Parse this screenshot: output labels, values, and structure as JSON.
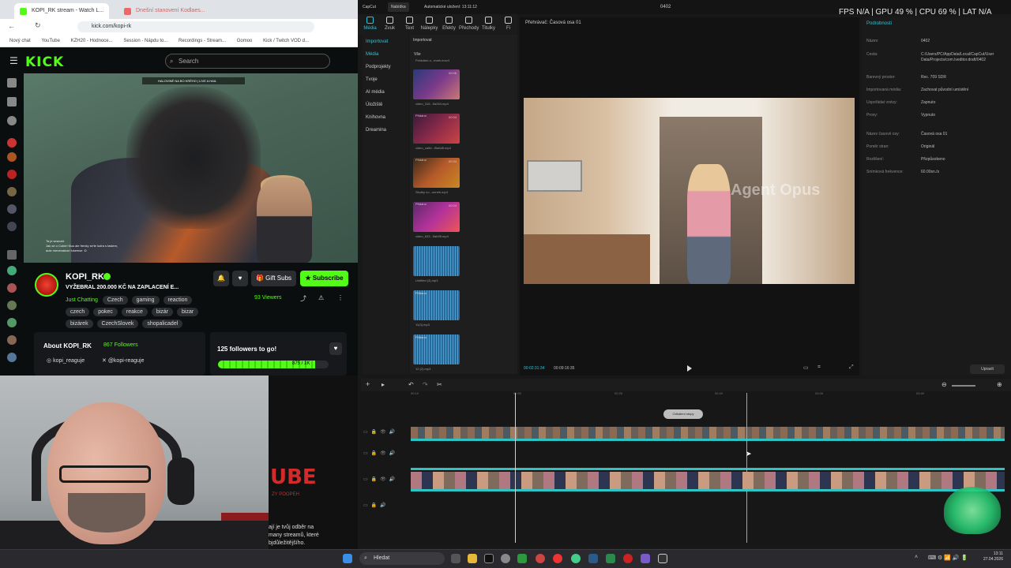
{
  "browser": {
    "tabs": [
      {
        "label": "KOPI_RK stream - Watch L..."
      },
      {
        "label": "Dnešní stanovení Kodlaes..."
      }
    ],
    "url": "kick.com/kopi-rk",
    "bookmarks": [
      "Nový chat",
      "YouTube",
      "KZH20 - Hodnoce...",
      "Session - Nápdu to...",
      "Recordings - Stream...",
      "Gomoo",
      "Kick / Twitch VOD d..."
    ],
    "logo": "KICK",
    "search_placeholder": "Search"
  },
  "stream": {
    "overlay_top": "HALOVINÉ NA BO KRÉHO | LIVE A HAIL",
    "chat_lines": [
      "Ta je seavokt",
      "Jak se u Cubie! Nuu ale frenky se'te ludra s taslem, ",
      "autz menenaluse lokemse :D"
    ],
    "channel_name": "KOPI_RK",
    "title": "VYŽEBRAL 200.000 KČ NA ZAPLACENÍ E...",
    "category": "Just Chatting",
    "tags_row1": [
      "Czech",
      "gaming",
      "reaction"
    ],
    "tags_row2": [
      "czech",
      "pokec",
      "reakce",
      "bizár",
      "bizar"
    ],
    "tags_row3": [
      "bizárek",
      "CzechSlovek",
      "shopalicadel"
    ],
    "gift_label": "Gift Subs",
    "subscribe_label": "Subscribe",
    "viewers": "93 Viewers",
    "about_label": "About KOPI_RK",
    "followers": "867 Followers",
    "social_1": "kopi_reaguje",
    "social_2": "@kopi-reaguje",
    "goal_text": "125 followers to go!",
    "goal_value": "875 / 1K",
    "goal_progress": 0.875
  },
  "behind": {
    "yt_word": "UBE",
    "yt_sub": "ZY POOPEH",
    "text": "ají je tvůj odběr na\nmany streamů, které\nbjdůležitějšího."
  },
  "capcut": {
    "top_left": "CapCut",
    "menu": "Nabídka",
    "autosave": "Automatické uložení: 13:11:12",
    "project": "0402",
    "tools": [
      "Média",
      "Zvuk",
      "Text",
      "Nálepky",
      "Efekty",
      "Přechody",
      "Titulky",
      "Fi"
    ],
    "import_label": "Importovat",
    "nav": [
      "Importovat",
      "Média",
      "Podprojekty",
      "Tvoje",
      "AI média",
      "Úložiště",
      "Knihovna",
      "Dreamina"
    ],
    "filter_all": "Vše",
    "media_items": [
      {
        "badge": "",
        "name": "Pořádání-o...mark.mov4"
      },
      {
        "badge": "",
        "name": "video_316...5a264.mp4"
      },
      {
        "badge": "Přidáno",
        "name": "video_ca5d...f5a6d5.mp4"
      },
      {
        "badge": "Přidáno",
        "name": "Skutky no...onneb.mp4"
      },
      {
        "badge": "Přidáno",
        "name": "video_633...5ab95.mp4"
      },
      {
        "badge": "",
        "name": "Untitled (3).mp3"
      },
      {
        "badge": "Přidáno",
        "name": "11(3).mp3"
      },
      {
        "badge": "Přidáno",
        "name": "12 (2).mp3"
      }
    ],
    "durations": [
      "",
      "00:06",
      "00:04",
      "00:34",
      "00:04"
    ],
    "player_title": "Přehrávač: Časová osa 01",
    "watermark": "Agent Opus",
    "timecode_current": "00:02:31:34",
    "timecode_total": "00:09:16:35",
    "details_title": "Podrobnosti",
    "details": [
      {
        "k": "Název:",
        "v": "0402"
      },
      {
        "k": "Cesta:",
        "v": "C:/Users/PC/AppData/Local/CapCut/User Data/Projects/com.lveditor.draft/0402"
      },
      {
        "k": "Barevný prostor:",
        "v": "Rec. 709 SDR"
      },
      {
        "k": "Importovaná média:",
        "v": "Zachovat původní umístění"
      },
      {
        "k": "Uspořádat vrstvy:",
        "v": "Zapnuto"
      },
      {
        "k": "Proxy:",
        "v": "Vypnuto"
      },
      {
        "k": "Název časové osy:",
        "v": "Časová osa 01"
      },
      {
        "k": "Poměr stran:",
        "v": "Originál"
      },
      {
        "k": "Rozlišení:",
        "v": "Přizpůsobeno"
      },
      {
        "k": "Snímková frekvence:",
        "v": "60.00sn./s"
      }
    ],
    "modify_label": "Upravit",
    "hud": "FPS N/A  |  GPU 49 %  |  CPU 69 %  |  LAT N/A",
    "ruler_ticks": [
      "00:10",
      "00:20",
      "02:25",
      "02:40",
      "03:26",
      "03:40"
    ],
    "tooltip": "Odhalení stopy"
  },
  "taskbar": {
    "search": "Hledat",
    "time": "13:11",
    "date": "27.04.2026"
  }
}
